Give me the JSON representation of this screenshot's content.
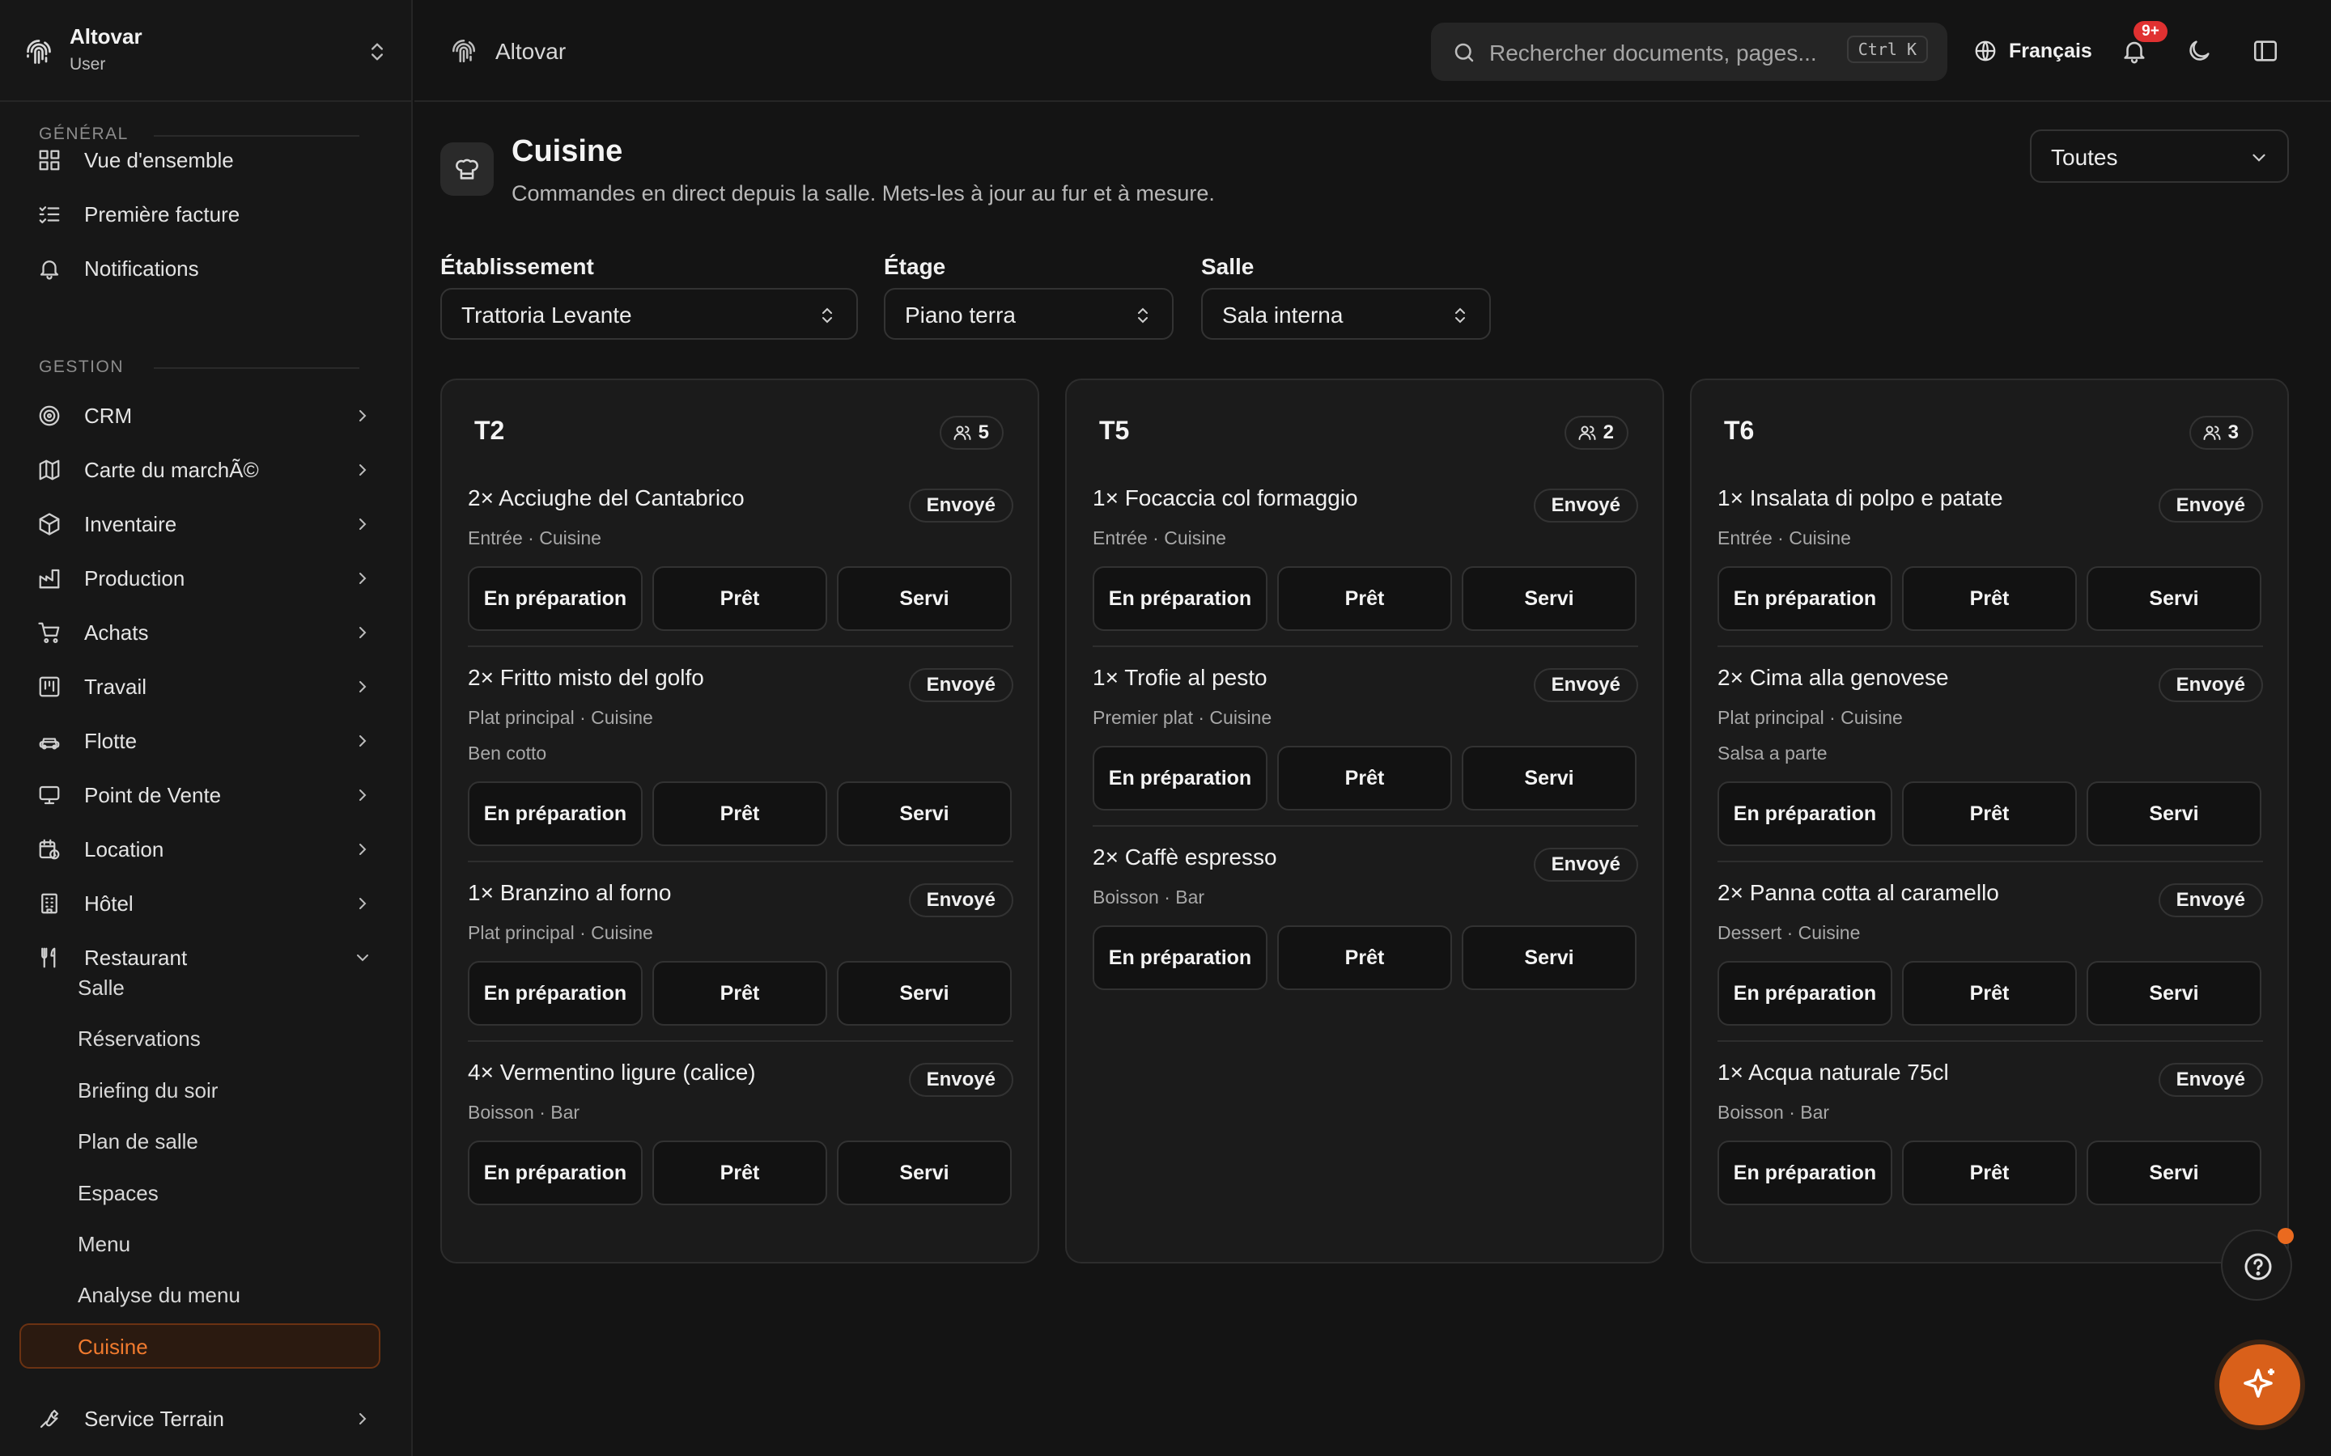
{
  "sidebar": {
    "brand": "Altovar",
    "role": "User",
    "section_general": "GÉNÉRAL",
    "section_gestion": "GESTION",
    "general_items": [
      {
        "label": "Vue d'ensemble",
        "icon": "dashboard-icon"
      },
      {
        "label": "Première facture",
        "icon": "checklist-icon"
      },
      {
        "label": "Notifications",
        "icon": "bell-icon"
      }
    ],
    "gestion_items": [
      {
        "label": "CRM",
        "icon": "target-icon"
      },
      {
        "label": "Carte du marchÃ©",
        "icon": "map-icon"
      },
      {
        "label": "Inventaire",
        "icon": "box-icon"
      },
      {
        "label": "Production",
        "icon": "factory-icon"
      },
      {
        "label": "Achats",
        "icon": "cart-icon"
      },
      {
        "label": "Travail",
        "icon": "kanban-icon"
      },
      {
        "label": "Flotte",
        "icon": "car-icon"
      },
      {
        "label": "Point de Vente",
        "icon": "monitor-icon"
      },
      {
        "label": "Location",
        "icon": "calendar-clock-icon"
      },
      {
        "label": "Hôtel",
        "icon": "building-icon"
      },
      {
        "label": "Restaurant",
        "icon": "utensils-icon"
      }
    ],
    "restaurant_sub": [
      "Salle",
      "Réservations",
      "Briefing du soir",
      "Plan de salle",
      "Espaces",
      "Menu",
      "Analyse du menu",
      "Cuisine"
    ],
    "active_sub": "Cuisine",
    "last_item": {
      "label": "Service Terrain",
      "icon": "wrench-icon"
    }
  },
  "topbar": {
    "title": "Altovar",
    "search_placeholder": "Rechercher documents, pages...",
    "search_shortcut": "Ctrl K",
    "language": "Français",
    "notif_count": "9+"
  },
  "page": {
    "title": "Cuisine",
    "subtitle": "Commandes en direct depuis la salle. Mets-les à jour au fur et à mesure.",
    "status_filter": "Toutes",
    "filters": [
      {
        "label": "Établissement",
        "value": "Trattoria Levante"
      },
      {
        "label": "Étage",
        "value": "Piano terra"
      },
      {
        "label": "Salle",
        "value": "Sala interna"
      }
    ]
  },
  "actions": [
    "En préparation",
    "Prêt",
    "Servi"
  ],
  "accent_color": "#e5671f",
  "tables": [
    {
      "name": "T2",
      "guests": "5",
      "items": [
        {
          "name": "2× Acciughe del Cantabrico",
          "status": "Envoyé",
          "meta": "Entrée · Cuisine",
          "note": ""
        },
        {
          "name": "2× Fritto misto del golfo",
          "status": "Envoyé",
          "meta": "Plat principal · Cuisine",
          "note": "Ben cotto"
        },
        {
          "name": "1× Branzino al forno",
          "status": "Envoyé",
          "meta": "Plat principal · Cuisine",
          "note": ""
        },
        {
          "name": "4× Vermentino ligure (calice)",
          "status": "Envoyé",
          "meta": "Boisson · Bar",
          "note": ""
        }
      ]
    },
    {
      "name": "T5",
      "guests": "2",
      "items": [
        {
          "name": "1× Focaccia col formaggio",
          "status": "Envoyé",
          "meta": "Entrée · Cuisine",
          "note": ""
        },
        {
          "name": "1× Trofie al pesto",
          "status": "Envoyé",
          "meta": "Premier plat · Cuisine",
          "note": ""
        },
        {
          "name": "2× Caffè espresso",
          "status": "Envoyé",
          "meta": "Boisson · Bar",
          "note": ""
        }
      ]
    },
    {
      "name": "T6",
      "guests": "3",
      "items": [
        {
          "name": "1× Insalata di polpo e patate",
          "status": "Envoyé",
          "meta": "Entrée · Cuisine",
          "note": ""
        },
        {
          "name": "2× Cima alla genovese",
          "status": "Envoyé",
          "meta": "Plat principal · Cuisine",
          "note": "Salsa a parte"
        },
        {
          "name": "2× Panna cotta al caramello",
          "status": "Envoyé",
          "meta": "Dessert · Cuisine",
          "note": ""
        },
        {
          "name": "1× Acqua naturale 75cl",
          "status": "Envoyé",
          "meta": "Boisson · Bar",
          "note": ""
        }
      ]
    }
  ]
}
